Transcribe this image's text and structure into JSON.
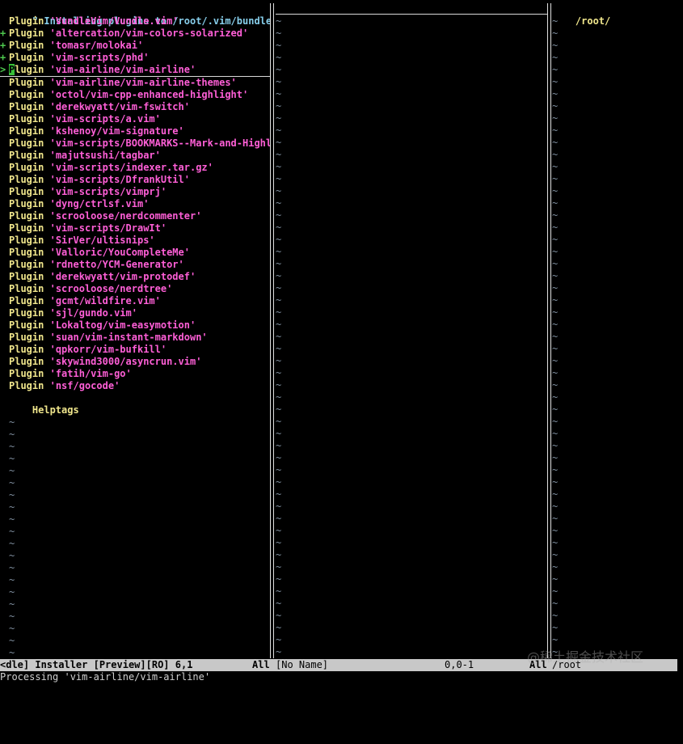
{
  "editor": {
    "header_comment": "\" Installing plugins to /root/.vim/bundle",
    "keyword_plugin": "Plugin",
    "plugins": [
      {
        "name": "'VundleVim/Vundle.vim'",
        "mark": "",
        "cursor": false
      },
      {
        "name": "'altercation/vim-colors-solarized'",
        "mark": "+",
        "cursor": false
      },
      {
        "name": "'tomasr/molokai'",
        "mark": "+",
        "cursor": false
      },
      {
        "name": "'vim-scripts/phd'",
        "mark": "+",
        "cursor": false
      },
      {
        "name": "'vim-airline/vim-airline'",
        "mark": ">",
        "cursor": true
      },
      {
        "name": "'vim-airline/vim-airline-themes'",
        "mark": "",
        "cursor": false
      },
      {
        "name": "'octol/vim-cpp-enhanced-highlight'",
        "mark": "",
        "cursor": false
      },
      {
        "name": "'derekwyatt/vim-fswitch'",
        "mark": "",
        "cursor": false
      },
      {
        "name": "'vim-scripts/a.vim'",
        "mark": "",
        "cursor": false
      },
      {
        "name": "'kshenoy/vim-signature'",
        "mark": "",
        "cursor": false
      },
      {
        "name": "'vim-scripts/BOOKMARKS--Mark-and-Highli",
        "mark": "",
        "cursor": false
      },
      {
        "name": "'majutsushi/tagbar'",
        "mark": "",
        "cursor": false
      },
      {
        "name": "'vim-scripts/indexer.tar.gz'",
        "mark": "",
        "cursor": false
      },
      {
        "name": "'vim-scripts/DfrankUtil'",
        "mark": "",
        "cursor": false
      },
      {
        "name": "'vim-scripts/vimprj'",
        "mark": "",
        "cursor": false
      },
      {
        "name": "'dyng/ctrlsf.vim'",
        "mark": "",
        "cursor": false
      },
      {
        "name": "'scrooloose/nerdcommenter'",
        "mark": "",
        "cursor": false
      },
      {
        "name": "'vim-scripts/DrawIt'",
        "mark": "",
        "cursor": false
      },
      {
        "name": "'SirVer/ultisnips'",
        "mark": "",
        "cursor": false
      },
      {
        "name": "'Valloric/YouCompleteMe'",
        "mark": "",
        "cursor": false
      },
      {
        "name": "'rdnetto/YCM-Generator'",
        "mark": "",
        "cursor": false
      },
      {
        "name": "'derekwyatt/vim-protodef'",
        "mark": "",
        "cursor": false
      },
      {
        "name": "'scrooloose/nerdtree'",
        "mark": "",
        "cursor": false
      },
      {
        "name": "'gcmt/wildfire.vim'",
        "mark": "",
        "cursor": false
      },
      {
        "name": "'sjl/gundo.vim'",
        "mark": "",
        "cursor": false
      },
      {
        "name": "'Lokaltog/vim-easymotion'",
        "mark": "",
        "cursor": false
      },
      {
        "name": "'suan/vim-instant-markdown'",
        "mark": "",
        "cursor": false
      },
      {
        "name": "'qpkorr/vim-bufkill'",
        "mark": "",
        "cursor": false
      },
      {
        "name": "'skywind3000/asyncrun.vim'",
        "mark": "",
        "cursor": false
      },
      {
        "name": "'fatih/vim-go'",
        "mark": "",
        "cursor": false
      },
      {
        "name": "'nsf/gocode'",
        "mark": "",
        "cursor": false
      }
    ],
    "helptags": "Helptags",
    "tilde": "~"
  },
  "right_pane": {
    "path": "/root/"
  },
  "statusbar": {
    "left_name": "<dle] Installer [Preview][RO] 6,1",
    "left_scroll": "All",
    "mid_name": "[No Name]",
    "mid_pos": "0,0-1",
    "right_scroll": "All",
    "right_name": "/root"
  },
  "cmdline": {
    "text": "Processing 'vim-airline/vim-airline'"
  },
  "watermark": {
    "text": "@稀土掘金技术社区"
  },
  "colors": {
    "keyword": "#f0e68c",
    "string": "#ff5fd7",
    "comment": "#87ceeb",
    "marker": "#4ec94e",
    "tilde": "#7f8f9f",
    "statusbar_bg": "#c8c8c8"
  }
}
